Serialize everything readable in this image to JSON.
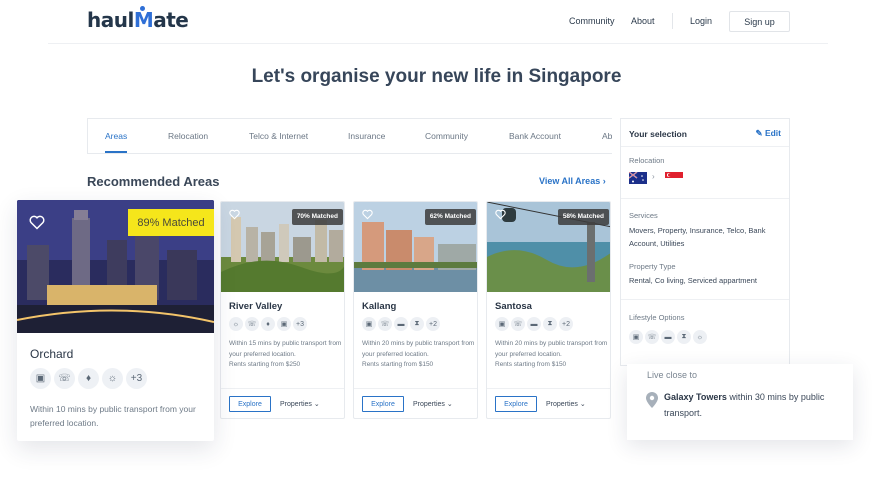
{
  "header": {
    "logo_prefix": "haul",
    "logo_m": "M",
    "logo_suffix": "ate",
    "nav": [
      "Community",
      "About",
      "Login"
    ],
    "signup": "Sign up"
  },
  "hero": {
    "title": "Let's organise your new life in Singapore"
  },
  "tabs": [
    "Areas",
    "Relocation",
    "Telco & Internet",
    "Insurance",
    "Community",
    "Bank Account",
    "Ab"
  ],
  "active_tab": "Areas",
  "recommended": {
    "title": "Recommended Areas",
    "view_all": "View All Areas",
    "featured": {
      "name": "Orchard",
      "match": "89% Matched",
      "icons": [
        "movers-icon",
        "telco-icon",
        "insurance-icon",
        "utilities-icon"
      ],
      "more": "+3",
      "description": "Within 10 mins by public transport from your preferred location."
    },
    "cards": [
      {
        "name": "River Valley",
        "match": "70% Matched",
        "icons": [
          "utilities-icon",
          "telco-icon",
          "insurance-icon",
          "movers-icon"
        ],
        "more": "+3",
        "description": "Within 15 mins by public transport from your preferred location.",
        "rent": "Rents starting from $250",
        "explore": "Explore",
        "properties": "Properties"
      },
      {
        "name": "Kallang",
        "match": "62% Matched",
        "icons": [
          "movers-icon",
          "telco-icon",
          "car-icon",
          "hourglass-icon"
        ],
        "more": "+2",
        "description": "Within 20 mins by public transport from your preferred location.",
        "rent": "Rents starting from $150",
        "explore": "Explore",
        "properties": "Properties"
      },
      {
        "name": "Santosa",
        "match": "58% Matched",
        "icons": [
          "movers-icon",
          "telco-icon",
          "car-icon",
          "hourglass-icon"
        ],
        "more": "+2",
        "description": "Within 20 mins by public transport from your preferred location.",
        "rent": "Rents starting from $150",
        "explore": "Explore",
        "properties": "Properties"
      }
    ]
  },
  "selection": {
    "title": "Your selection",
    "edit": "Edit",
    "relocation_label": "Relocation",
    "services_label": "Services",
    "services_value": "Movers, Property, Insurance, Telco, Bank Account, Utilities",
    "property_type_label": "Property Type",
    "property_type_value": "Rental, Co living, Serviced appartment",
    "lifestyle_label": "Lifestyle Options"
  },
  "live_close": {
    "label": "Live close to",
    "place": "Galaxy Towers",
    "rest": " within 30 mins by public transport."
  },
  "colors": {
    "accent": "#2a73c7",
    "badge_yellow": "#f5e61b"
  }
}
